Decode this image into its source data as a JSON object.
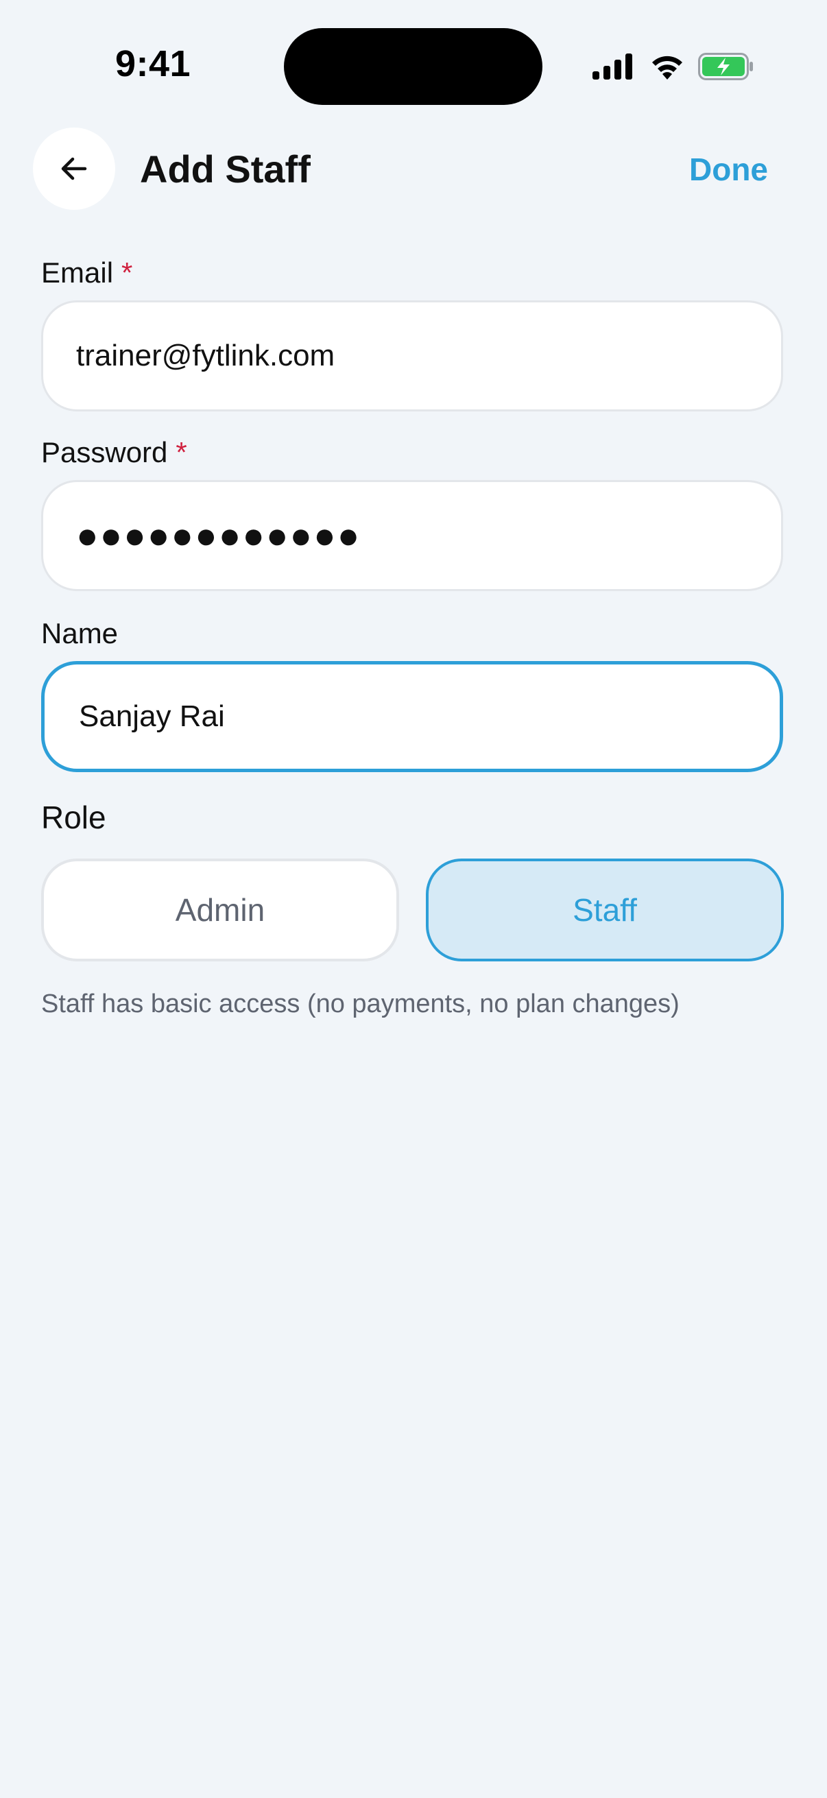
{
  "status_bar": {
    "time": "9:41",
    "icons": [
      "signal-icon",
      "wifi-icon",
      "battery-charging-icon"
    ]
  },
  "header": {
    "back_icon": "arrow-left-icon",
    "title": "Add Staff",
    "done_label": "Done"
  },
  "form": {
    "email": {
      "label": "Email",
      "required_mark": "*",
      "value": "trainer@fytlink.com"
    },
    "password": {
      "label": "Password",
      "required_mark": "*",
      "value": "●●●●●●●●●●●●"
    },
    "name": {
      "label": "Name",
      "value": "Sanjay Rai"
    },
    "role": {
      "label": "Role",
      "options": [
        "Admin",
        "Staff"
      ],
      "selected": "Staff",
      "help_text": "Staff has basic access (no payments, no plan changes)"
    }
  },
  "colors": {
    "accent": "#2d9fd8",
    "required": "#d0213f",
    "background": "#f1f5f9",
    "selected_fill": "#d6eaf6"
  }
}
